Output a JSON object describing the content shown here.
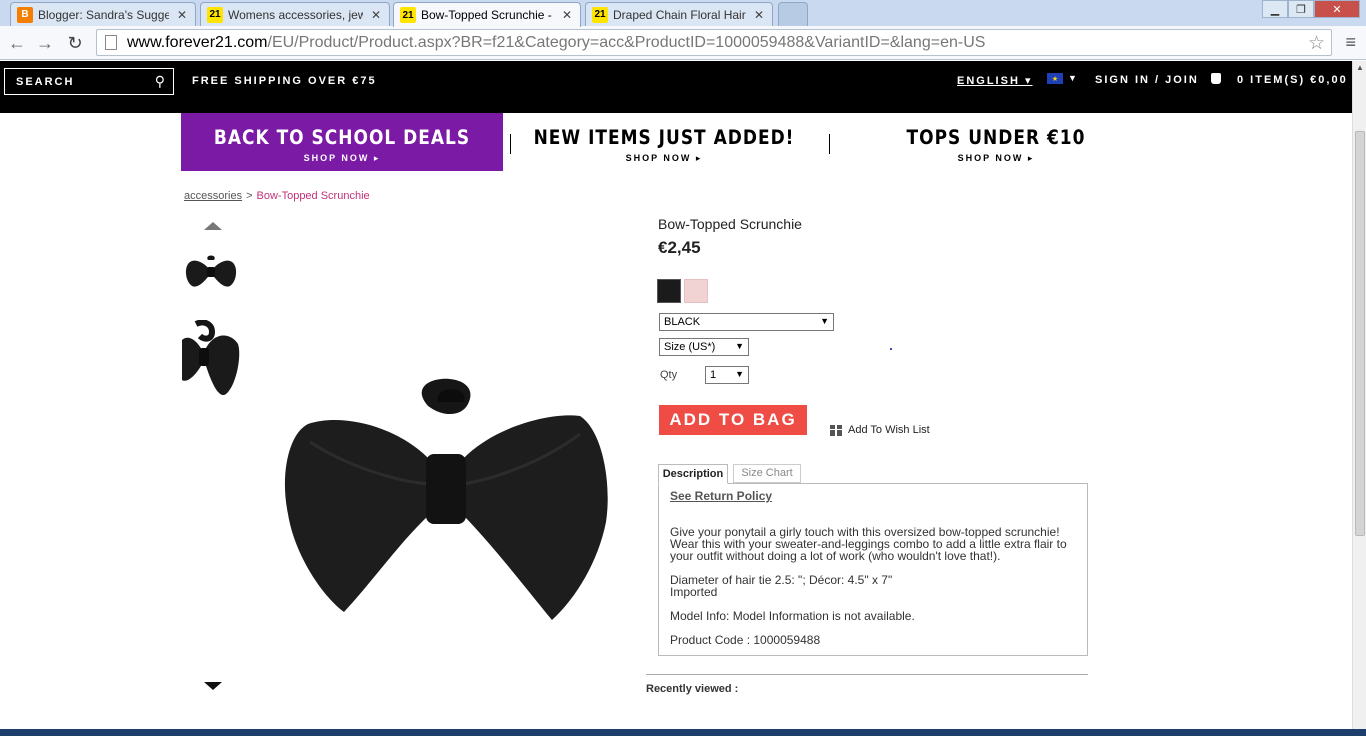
{
  "browser": {
    "tabs": [
      {
        "title": "Blogger: Sandra's Suggest",
        "favicon": "blogger-icon",
        "active": false
      },
      {
        "title": "Womens accessories, jewe",
        "favicon": "forever21-icon",
        "active": false
      },
      {
        "title": "Bow-Topped Scrunchie - ",
        "favicon": "forever21-icon",
        "active": true
      },
      {
        "title": "Draped Chain Floral Haircl",
        "favicon": "forever21-icon",
        "active": false
      }
    ],
    "favicon_text": "21",
    "url_host": "www.forever21.com",
    "url_path": "/EU/Product/Product.aspx?BR=f21&Category=acc&ProductID=1000059488&VariantID=&lang=en-US"
  },
  "header": {
    "search_placeholder": "SEARCH",
    "free_shipping": "FREE SHIPPING OVER €75",
    "language": "ENGLISH ▾",
    "sign_in": "SIGN IN / JOIN",
    "bag": "0 ITEM(S)  €0,00"
  },
  "promos": [
    {
      "title": "BACK TO SCHOOL DEALS",
      "cta": "SHOP NOW ▸"
    },
    {
      "title": "NEW ITEMS JUST ADDED!",
      "cta": "SHOP NOW ▸"
    },
    {
      "title": "TOPS UNDER €10",
      "cta": "SHOP NOW ▸"
    }
  ],
  "breadcrumb": {
    "parent": "accessories",
    "separator": ">",
    "current": "Bow-Topped Scrunchie"
  },
  "product": {
    "title": "Bow-Topped Scrunchie",
    "price": "€2,45",
    "swatch_colors": [
      "#1b1b1b",
      "#f2d3d4"
    ],
    "color_select": "BLACK",
    "size_select": "Size (US*)",
    "qty_label": "Qty",
    "qty_value": "1",
    "add_to_bag": "ADD TO BAG",
    "wishlist": "Add To Wish List"
  },
  "details": {
    "tab_description": "Description",
    "tab_size_chart": "Size Chart",
    "return_policy": "See Return Policy",
    "description": "Give your ponytail a girly touch with this oversized bow-topped scrunchie! Wear this with your sweater-and-leggings combo to add a little extra flair to your outfit without doing a lot of work (who wouldn't love that!).",
    "dimensions": "Diameter of hair tie 2.5: \"; Décor: 4.5\" x 7\"",
    "origin": "Imported",
    "model_info": "Model Info:  Model Information is not available.",
    "product_code": "Product Code : 1000059488"
  },
  "recently_viewed": "Recently viewed :",
  "colors": {
    "promo_purple": "#7a1aa5",
    "add_to_bag": "#ee4c44",
    "breadcrumb_current": "#c0337a"
  }
}
